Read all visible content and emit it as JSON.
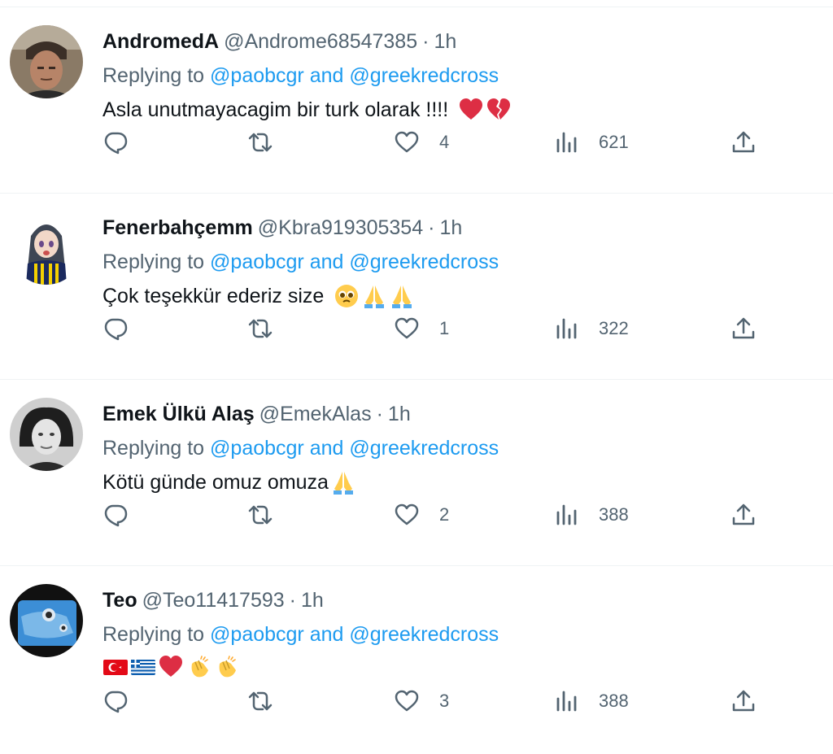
{
  "replies": [
    {
      "name": "AndromedA",
      "handle": "@Androme68547385",
      "sep": "·",
      "time": "1h",
      "replying_prefix": "Replying to",
      "replying_mentions": "@paobcgr and @greekredcross",
      "text": "Asla unutmayacagim bir turk olarak !!!!",
      "emojis": [
        "red-heart-emoji",
        "broken-heart-emoji"
      ],
      "likes": "4",
      "views": "621"
    },
    {
      "name": "Fenerbahçemm",
      "handle": "@Kbra919305354",
      "sep": "·",
      "time": "1h",
      "replying_prefix": "Replying to",
      "replying_mentions": "@paobcgr and @greekredcross",
      "text": "Çok teşekkür ederiz size",
      "emojis": [
        "pleading-face-emoji",
        "folded-hands-emoji",
        "folded-hands-emoji"
      ],
      "likes": "1",
      "views": "322"
    },
    {
      "name": "Emek Ülkü Alaş",
      "handle": "@EmekAlas",
      "sep": "·",
      "time": "1h",
      "replying_prefix": "Replying to",
      "replying_mentions": "@paobcgr and @greekredcross",
      "text": "Kötü günde omuz omuza",
      "emojis": [
        "folded-hands-emoji"
      ],
      "likes": "2",
      "views": "388"
    },
    {
      "name": "Teo",
      "handle": "@Teo11417593",
      "sep": "·",
      "time": "1h",
      "replying_prefix": "Replying to",
      "replying_mentions": "@paobcgr and @greekredcross",
      "text": "",
      "emojis": [
        "turkey-flag-emoji",
        "greece-flag-emoji",
        "red-heart-emoji",
        "clapping-hands-emoji",
        "clapping-hands-emoji"
      ],
      "likes": "3",
      "views": "388"
    }
  ],
  "colors": {
    "text": "#0f1419",
    "secondary": "#536471",
    "link": "#1d9bf0",
    "divider": "#eff3f4"
  },
  "icons": {
    "reply": "reply-icon",
    "retweet": "retweet-icon",
    "like": "heart-icon",
    "views": "views-icon",
    "share": "share-icon"
  }
}
